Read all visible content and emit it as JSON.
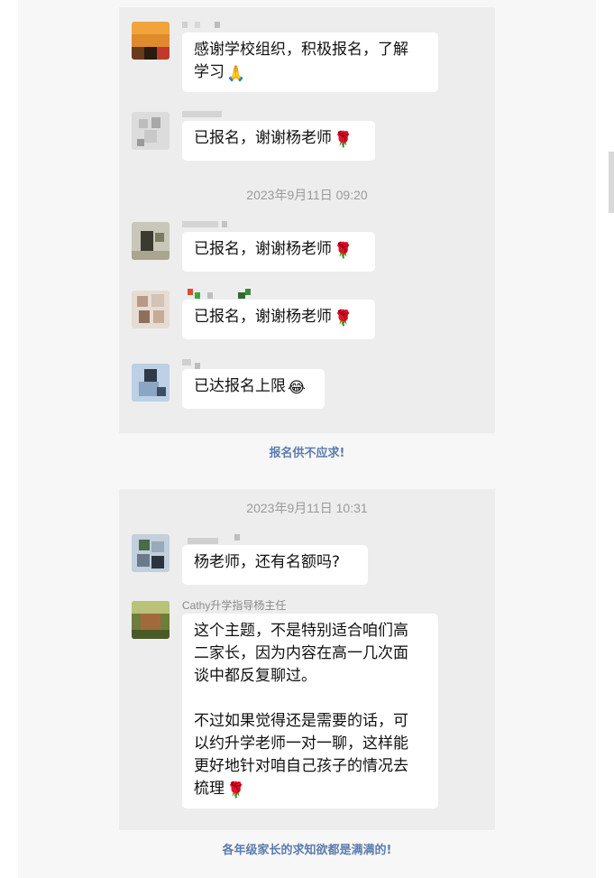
{
  "panel1": {
    "timestamp": "2023年9月11日 09:20",
    "messages": [
      {
        "text_line1": "感谢学校组织，积极报名，了解",
        "text_line2": "学习",
        "emoji": "🙏"
      },
      {
        "text": "已报名，谢谢杨老师",
        "emoji": "🌹"
      },
      {
        "text": "已报名，谢谢杨老师",
        "emoji": "🌹"
      },
      {
        "text": "已报名，谢谢杨老师",
        "emoji": "🌹"
      },
      {
        "text": "已达报名上限",
        "emoji": "😂"
      }
    ]
  },
  "caption1": "报名供不应求!",
  "panel2": {
    "timestamp": "2023年9月11日 10:31",
    "question": {
      "text": "杨老师，还有名额吗?"
    },
    "reply": {
      "sender": "Cathy升学指导杨主任",
      "para1_lines": [
        "这个主题，不是特别适合咱们高",
        "二家长，因为内容在高一几次面",
        "谈中都反复聊过。"
      ],
      "para2_lines": [
        "不过如果觉得还是需要的话，可",
        "以约升学老师一对一聊，这样能",
        "更好地针对咱自己孩子的情况去",
        "梳理"
      ],
      "emoji": "🌹"
    }
  },
  "caption2": "各年级家长的求知欲都是满满的!",
  "colors": {
    "caption": "#5a7cad",
    "panel": "#ededed",
    "bubble": "#ffffff",
    "page": "#f7f7f7"
  }
}
